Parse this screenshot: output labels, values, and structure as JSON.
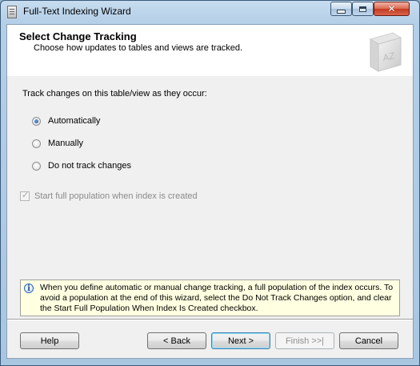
{
  "window": {
    "title": "Full-Text Indexing Wizard"
  },
  "header": {
    "title": "Select Change Tracking",
    "subtitle": "Choose how updates to tables and views are tracked.",
    "book_label": "AZ"
  },
  "main": {
    "question": "Track changes on this table/view as they occur:",
    "options": [
      {
        "label": "Automatically",
        "checked": true
      },
      {
        "label": "Manually",
        "checked": false
      },
      {
        "label": "Do not track changes",
        "checked": false
      }
    ],
    "start_population": {
      "label": "Start full population when index is created",
      "checked": true,
      "enabled": false
    },
    "info_text": "When you define automatic or manual change tracking, a full population of the index occurs. To avoid a population at the end of this wizard, select the Do Not Track Changes option, and clear the Start Full Population When Index Is Created checkbox."
  },
  "buttons": {
    "help": "Help",
    "back": "< Back",
    "next": "Next >",
    "finish": "Finish >>|",
    "cancel": "Cancel"
  },
  "colors": {
    "info_background": "#ffffe1",
    "title_bar": "#b4cfe8",
    "close_button": "#c3391f"
  }
}
